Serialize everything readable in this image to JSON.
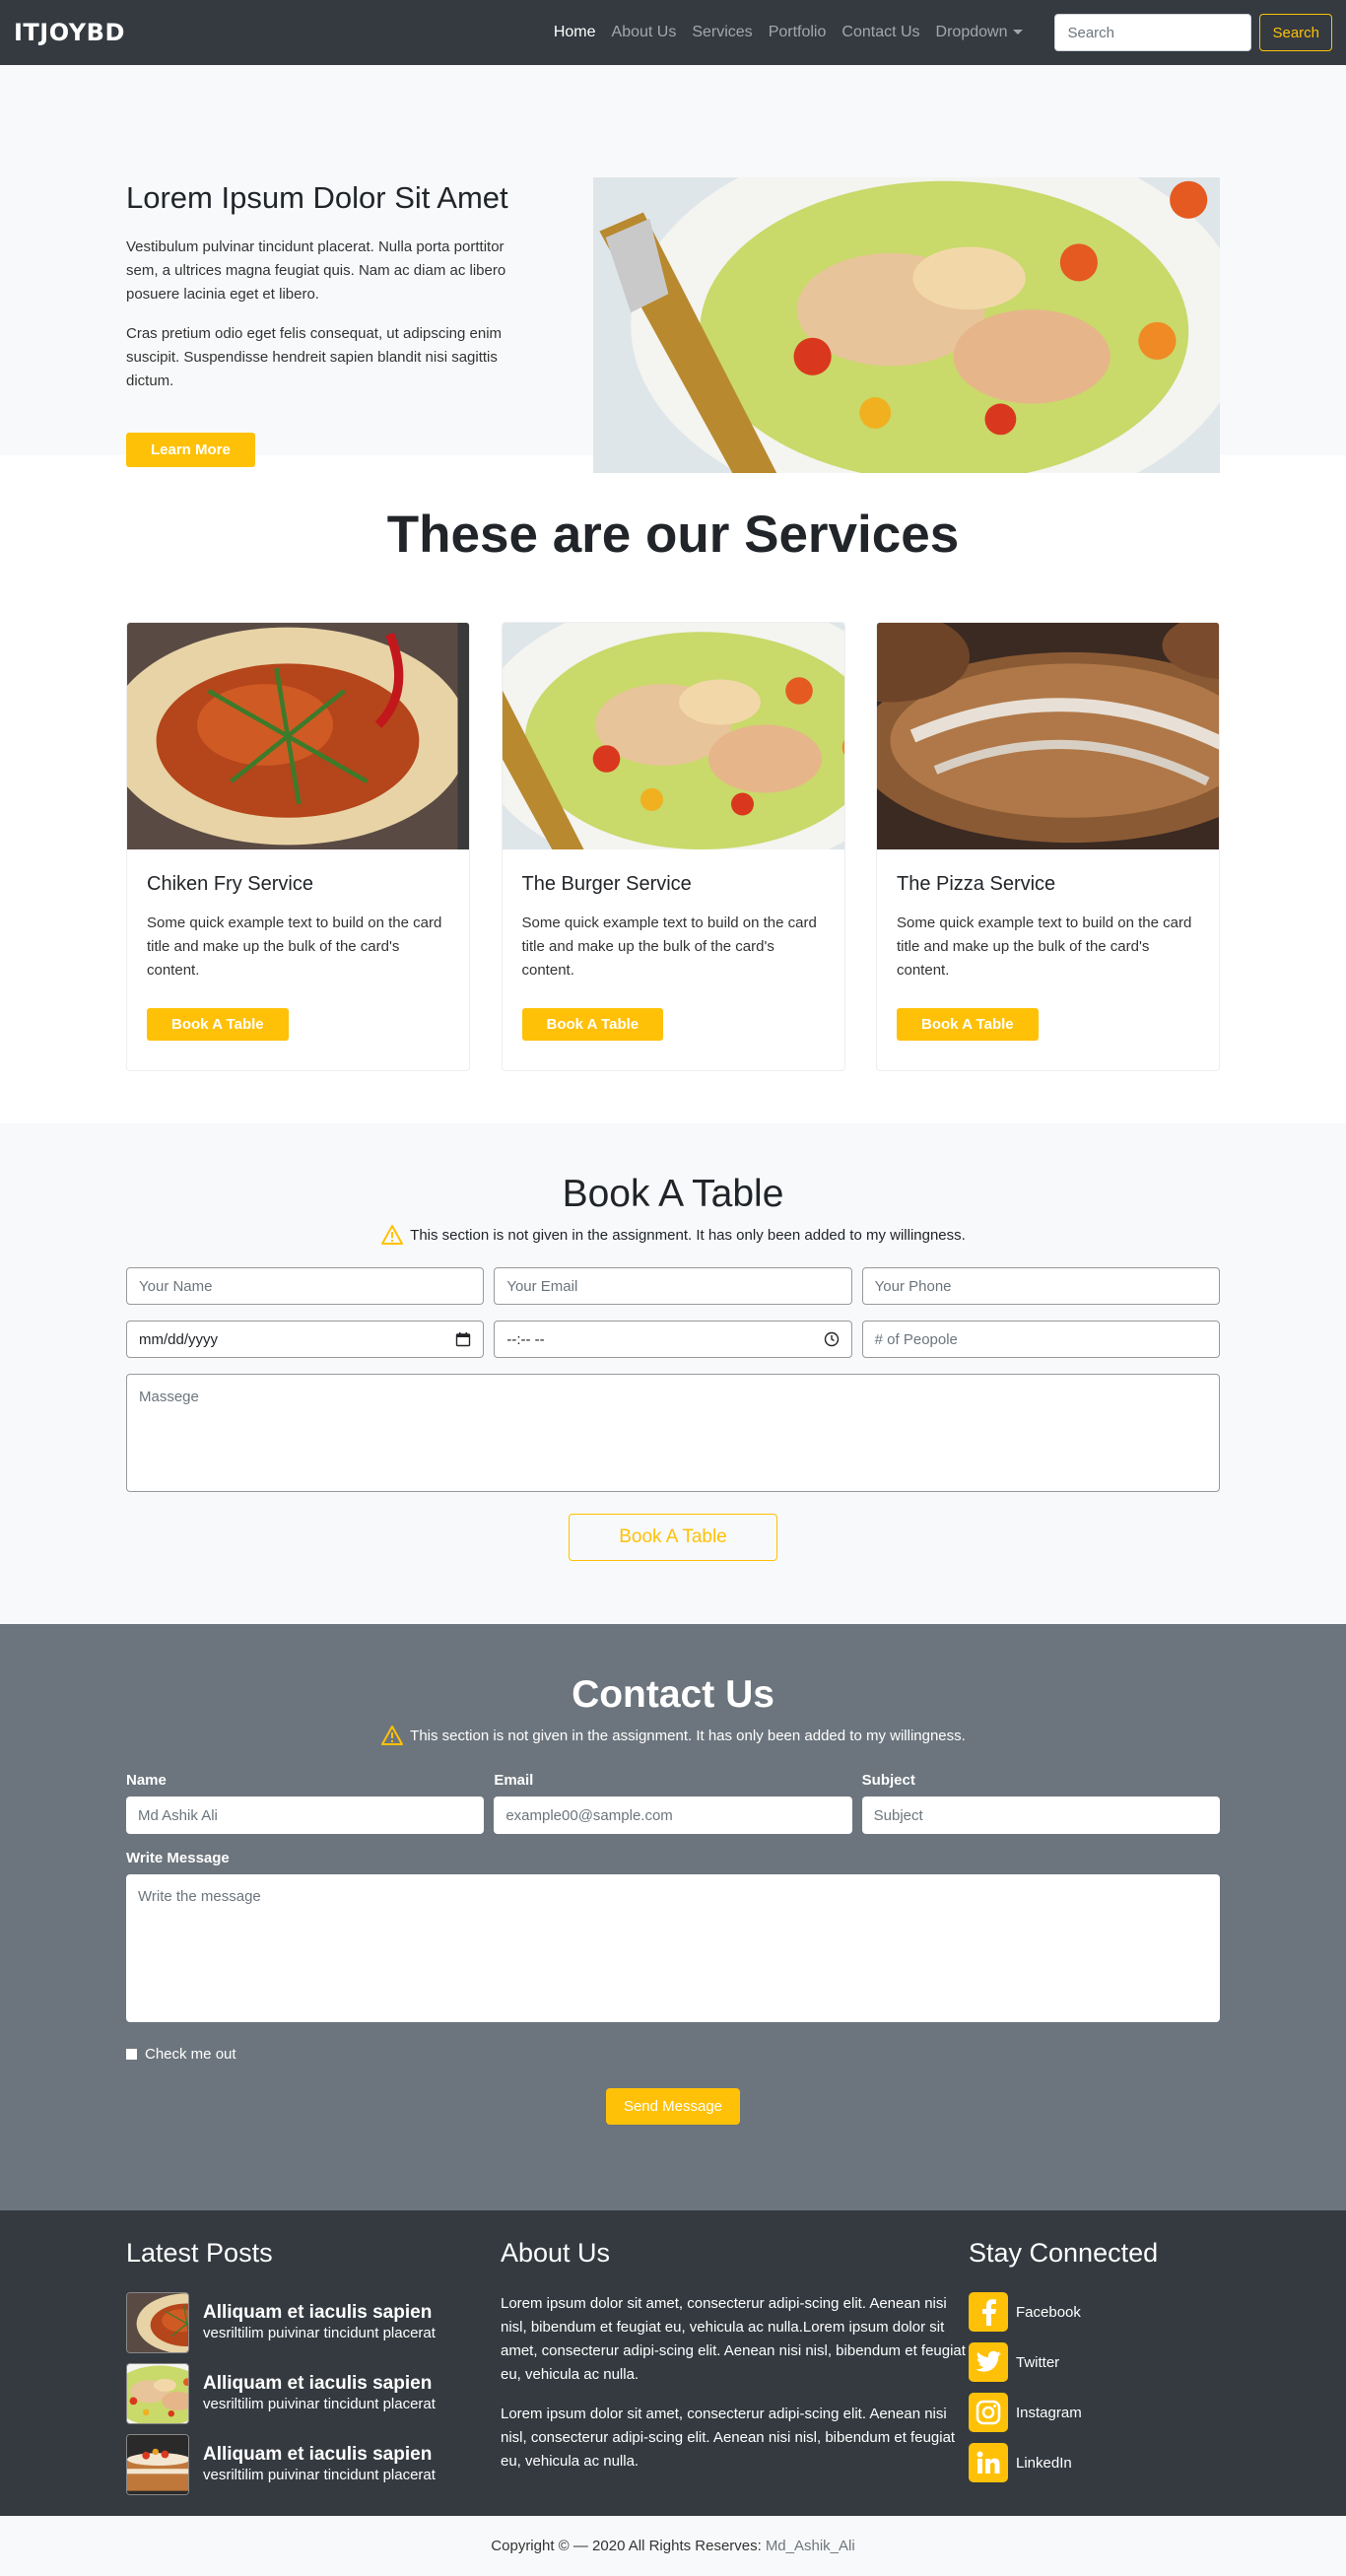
{
  "nav": {
    "brand": "ITJOYBD",
    "links": [
      "Home",
      "About Us",
      "Services",
      "Portfolio",
      "Contact Us",
      "Dropdown"
    ],
    "search_placeholder": "Search",
    "search_button": "Search"
  },
  "hero": {
    "title": "Lorem Ipsum Dolor Sit Amet",
    "p1": "Vestibulum pulvinar tincidunt placerat. Nulla porta porttitor sem, a ultrices magna feugiat quis. Nam ac diam ac libero posuere lacinia eget et libero.",
    "p2": "Cras pretium odio eget felis consequat, ut adipscing enim suscipit. Suspendisse hendreit sapien blandit nisi sagittis dictum.",
    "button": "Learn More"
  },
  "services": {
    "title": "These are our Services",
    "cards": [
      {
        "title": "Chiken Fry Service",
        "text": "Some quick example text to build on the card title and make up the bulk of the card's content.",
        "button": "Book A Table"
      },
      {
        "title": "The Burger Service",
        "text": "Some quick example text to build on the card title and make up the bulk of the card's content.",
        "button": "Book A Table"
      },
      {
        "title": "The Pizza Service",
        "text": "Some quick example text to build on the card title and make up the bulk of the card's content.",
        "button": "Book A Table"
      }
    ]
  },
  "book": {
    "title": "Book A Table",
    "note": "This section is not given in the assignment. It has only been added to my willingness.",
    "name_placeholder": "Your Name",
    "email_placeholder": "Your Email",
    "phone_placeholder": "Your Phone",
    "date_value": "mm/dd/yyyy",
    "time_value": "--:-- --",
    "people_placeholder": "# of Peopole",
    "message_placeholder": "Massege",
    "button": "Book A Table"
  },
  "contact": {
    "title": "Contact Us",
    "note": "This section is not given in the assignment. It has only been added to my willingness.",
    "name_label": "Name",
    "name_placeholder": "Md Ashik Ali",
    "email_label": "Email",
    "email_placeholder": "example00@sample.com",
    "subject_label": "Subject",
    "subject_placeholder": "Subject",
    "message_label": "Write Message",
    "message_placeholder": "Write the message",
    "check_label": "Check me out",
    "button": "Send Message"
  },
  "footer": {
    "posts_title": "Latest Posts",
    "posts": [
      {
        "title": "Alliquam et iaculis sapien",
        "text": "vesriltilim puivinar tincidunt placerat"
      },
      {
        "title": "Alliquam et iaculis sapien",
        "text": "vesriltilim puivinar tincidunt placerat"
      },
      {
        "title": "Alliquam et iaculis sapien",
        "text": "vesriltilim puivinar tincidunt placerat"
      }
    ],
    "about_title": "About Us",
    "about_p1": "Lorem ipsum dolor sit amet, consecterur adipi-scing elit. Aenean nisi nisl, bibendum et feugiat eu, vehicula ac nulla.Lorem ipsum dolor sit amet, consecterur adipi-scing elit. Aenean nisi nisl, bibendum et feugiat eu, vehicula ac nulla.",
    "about_p2": "Lorem ipsum dolor sit amet, consecterur adipi-scing elit. Aenean nisi nisl, consecterur adipi-scing elit. Aenean nisi nisl, bibendum et feugiat eu, vehicula ac nulla.",
    "social_title": "Stay Connected",
    "social": [
      "Facebook",
      "Twitter",
      "Instagram",
      "LinkedIn"
    ]
  },
  "bottom": {
    "copyright": "Copyright © — 2020 All Rights Reserves:",
    "author": "Md_Ashik_Ali"
  },
  "colors": {
    "accent": "#ffc107",
    "dark": "#343a40",
    "gray": "#6c757d",
    "light": "#f8f9fa"
  }
}
